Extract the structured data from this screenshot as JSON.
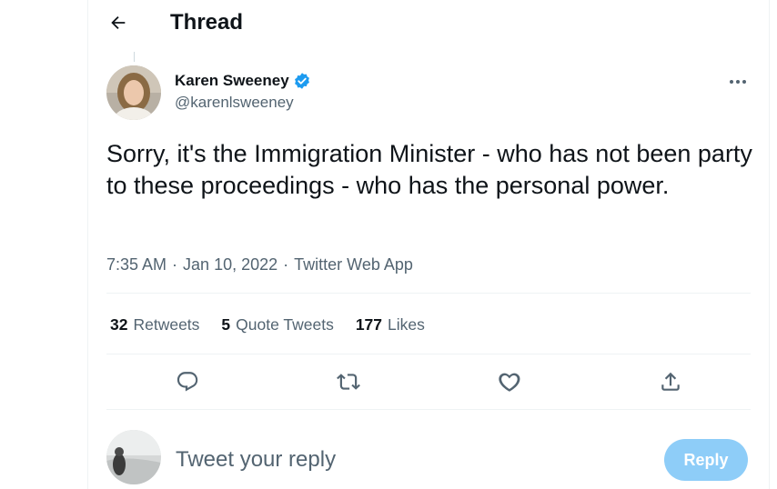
{
  "header": {
    "title": "Thread",
    "back_icon": "arrow-left-icon"
  },
  "tweet": {
    "author": {
      "display_name": "Karen Sweeney",
      "handle": "@karenlsweeney",
      "verified": true,
      "verified_color": "#1d9bf0"
    },
    "text": "Sorry, it's the Immigration Minister - who has not been party to these proceedings - who has the personal power.",
    "time": "7:35 AM",
    "separator": "·",
    "date": "Jan 10, 2022",
    "source": "Twitter Web App",
    "stats": {
      "retweets": {
        "count": "32",
        "label": "Retweets"
      },
      "quote_tweets": {
        "count": "5",
        "label": "Quote Tweets"
      },
      "likes": {
        "count": "177",
        "label": "Likes"
      }
    },
    "actions": [
      "reply-icon",
      "retweet-icon",
      "like-icon",
      "share-icon"
    ]
  },
  "reply": {
    "placeholder": "Tweet your reply",
    "button_label": "Reply",
    "button_color": "#8ecdf8"
  },
  "colors": {
    "text_primary": "#0f1419",
    "text_secondary": "#536471",
    "divider": "#eff3f4"
  }
}
